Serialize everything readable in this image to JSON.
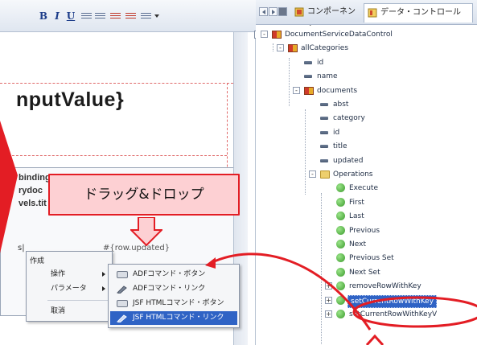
{
  "editor": {
    "expression": "nputValue}",
    "binding_lines": [
      "binding",
      "rydoc",
      "vels.tit"
    ],
    "col_left": "s|",
    "col_row_updated": "#{row.updated}"
  },
  "callout": {
    "text": "ドラッグ&ドロップ"
  },
  "context_menu": {
    "header": "作成",
    "items": [
      {
        "label": "操作",
        "has_submenu": true
      },
      {
        "label": "パラメータ",
        "has_submenu": true
      },
      {
        "label": "取消",
        "has_submenu": false
      }
    ]
  },
  "sub_menu": {
    "items": [
      {
        "label": "ADFコマンド・ボタン",
        "icon": "button-icon",
        "selected": false
      },
      {
        "label": "ADFコマンド・リンク",
        "icon": "link-icon",
        "selected": false
      },
      {
        "label": "JSF HTMLコマンド・ボタン",
        "icon": "button-icon",
        "selected": false
      },
      {
        "label": "JSF HTMLコマンド・リンク",
        "icon": "link-icon",
        "selected": true
      }
    ]
  },
  "panel": {
    "tabs": [
      {
        "label": "コンポーネント",
        "active": false
      },
      {
        "label": "データ・コントロール",
        "active": true
      }
    ],
    "tree": [
      {
        "label": "DocumentServiceDataControl",
        "icon": "datacontrol-icon",
        "level": 0,
        "toggle": "-"
      },
      {
        "label": "allCategories",
        "icon": "collection-icon",
        "level": 1,
        "toggle": "-"
      },
      {
        "label": "id",
        "icon": "attribute-icon",
        "level": 2,
        "toggle": ""
      },
      {
        "label": "name",
        "icon": "attribute-icon",
        "level": 2,
        "toggle": ""
      },
      {
        "label": "documents",
        "icon": "collection-icon",
        "level": 2,
        "toggle": "-"
      },
      {
        "label": "abst",
        "icon": "attribute-icon",
        "level": 3,
        "toggle": ""
      },
      {
        "label": "category",
        "icon": "attribute-icon",
        "level": 3,
        "toggle": ""
      },
      {
        "label": "id",
        "icon": "attribute-icon",
        "level": 3,
        "toggle": ""
      },
      {
        "label": "title",
        "icon": "attribute-icon",
        "level": 3,
        "toggle": ""
      },
      {
        "label": "updated",
        "icon": "attribute-icon",
        "level": 3,
        "toggle": ""
      },
      {
        "label": "Operations",
        "icon": "folder-icon",
        "level": 3,
        "toggle": "-"
      },
      {
        "label": "Execute",
        "icon": "operation-icon",
        "level": 4,
        "toggle": ""
      },
      {
        "label": "First",
        "icon": "operation-icon",
        "level": 4,
        "toggle": ""
      },
      {
        "label": "Last",
        "icon": "operation-icon",
        "level": 4,
        "toggle": ""
      },
      {
        "label": "Previous",
        "icon": "operation-icon",
        "level": 4,
        "toggle": ""
      },
      {
        "label": "Next",
        "icon": "operation-icon",
        "level": 4,
        "toggle": ""
      },
      {
        "label": "Previous Set",
        "icon": "operation-icon",
        "level": 4,
        "toggle": ""
      },
      {
        "label": "Next Set",
        "icon": "operation-icon",
        "level": 4,
        "toggle": ""
      },
      {
        "label": "removeRowWithKey",
        "icon": "operation-icon",
        "level": 4,
        "toggle": "+"
      },
      {
        "label": "setCurrentRowWithKey",
        "icon": "operation-icon",
        "level": 4,
        "toggle": "+",
        "selected": true
      },
      {
        "label": "setCurrentRowWithKeyV",
        "icon": "operation-icon",
        "level": 4,
        "toggle": "+"
      }
    ]
  },
  "colors": {
    "accent_red": "#e31d24",
    "callout_fill": "#fdd0d3",
    "selection": "#2f63c5"
  }
}
